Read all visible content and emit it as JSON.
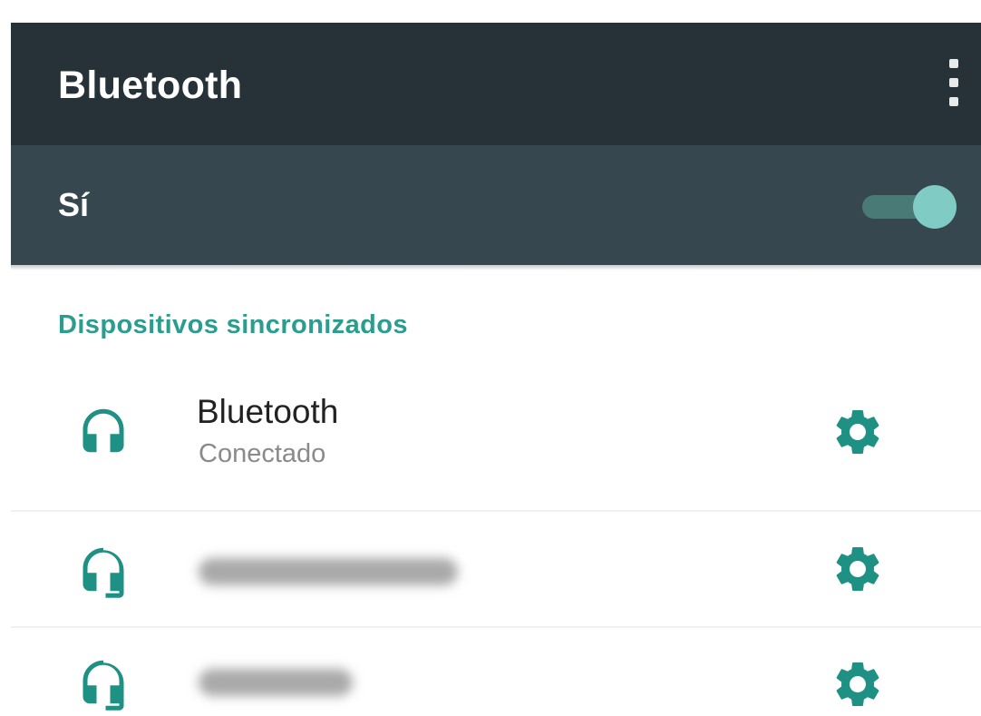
{
  "appbar": {
    "title": "Bluetooth",
    "overflow_icon": "more-vert-icon",
    "bg_color": "#263238"
  },
  "bluetooth_toggle": {
    "label": "Sí",
    "state": "on",
    "bg_color": "#37474f",
    "thumb_color": "#80cbc4"
  },
  "paired_devices": {
    "header": "Dispositivos sincronizados",
    "accent_color": "#2a9d8f",
    "devices": [
      {
        "name": "Bluetooth",
        "status": "Conectado",
        "name_redacted": false,
        "icon": "headset-icon",
        "settings_icon": "gear-icon"
      },
      {
        "name": "",
        "status": "",
        "name_redacted": true,
        "icon": "headset-icon",
        "settings_icon": "gear-icon"
      },
      {
        "name": "",
        "status": "",
        "name_redacted": true,
        "icon": "headset-icon",
        "settings_icon": "gear-icon"
      }
    ]
  }
}
